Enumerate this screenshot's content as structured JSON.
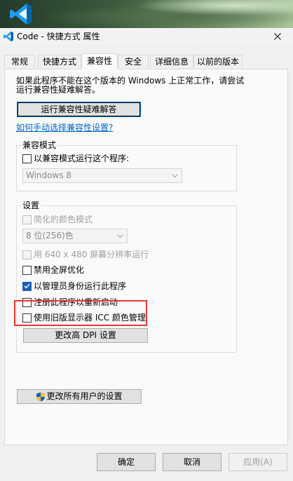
{
  "window": {
    "title": "Code - 快捷方式 属性",
    "close_icon": "close-icon"
  },
  "tabs": [
    {
      "label": "常规",
      "active": false
    },
    {
      "label": "快捷方式",
      "active": false
    },
    {
      "label": "兼容性",
      "active": true
    },
    {
      "label": "安全",
      "active": false
    },
    {
      "label": "详细信息",
      "active": false
    },
    {
      "label": "以前的版本",
      "active": false
    }
  ],
  "compat": {
    "intro_line1": "如果此程序不能在这个版本的 Windows 上正常工作，请尝试",
    "intro_line2": "运行兼容性疑难解答。",
    "troubleshoot_button": "运行兼容性疑难解答",
    "manual_link": "如何手动选择兼容性设置?"
  },
  "compat_mode": {
    "group_label": "兼容模式",
    "checkbox_label": "以兼容模式运行这个程序:",
    "checked": false,
    "selected_os": "Windows 8"
  },
  "settings": {
    "group_label": "设置",
    "reduced_color": {
      "label": "简化的颜色模式",
      "checked": false,
      "enabled": false
    },
    "color_depth": "8 位(256)色",
    "low_res": {
      "label": "用 640 x 480 屏幕分辨率运行",
      "checked": false,
      "enabled": false
    },
    "disable_fullscreen": {
      "label": "禁用全屏优化",
      "checked": false,
      "enabled": true
    },
    "run_as_admin": {
      "label": "以管理员身份运行此程序",
      "checked": true,
      "enabled": true
    },
    "register_restart": {
      "label": "注册此程序以重新启动",
      "checked": false,
      "enabled": true
    },
    "legacy_icc": {
      "label": "使用旧版显示器 ICC 颜色管理",
      "checked": false,
      "enabled": true
    },
    "dpi_button": "更改高 DPI 设置"
  },
  "all_users_button": "更改所有用户的设置",
  "footer": {
    "ok": "确定",
    "cancel": "取消",
    "apply": "应用(A)"
  },
  "colors": {
    "accent": "#1a5fb4",
    "highlight": "#e53935",
    "link": "#0066cc"
  }
}
